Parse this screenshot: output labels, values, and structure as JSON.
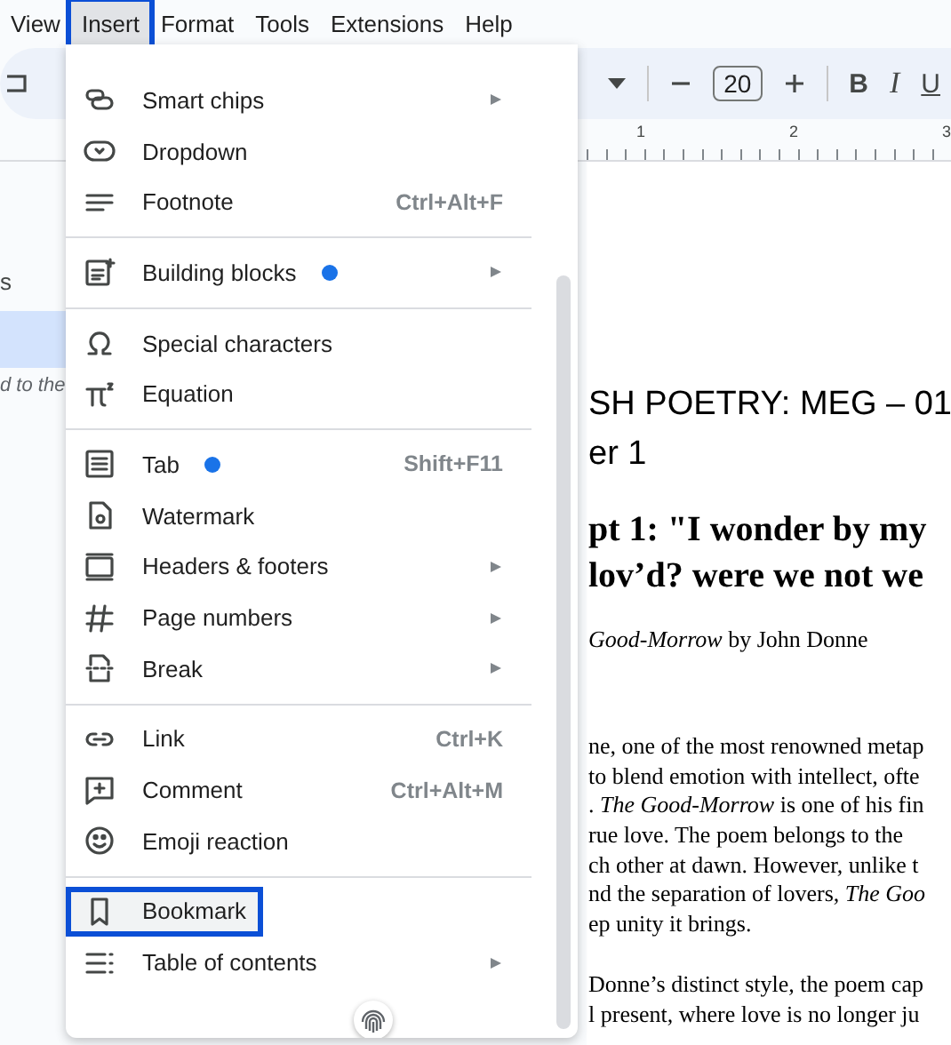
{
  "menu_bar": [
    {
      "label": "View",
      "selected": false,
      "annotated": false
    },
    {
      "label": "Insert",
      "selected": true,
      "annotated": true
    },
    {
      "label": "Format",
      "selected": false,
      "annotated": false
    },
    {
      "label": "Tools",
      "selected": false,
      "annotated": false
    },
    {
      "label": "Extensions",
      "selected": false,
      "annotated": false
    },
    {
      "label": "Help",
      "selected": false,
      "annotated": false
    }
  ],
  "toolbar": {
    "font_size": "20",
    "bold": "B",
    "italic": "I",
    "underline": "U"
  },
  "ruler": [
    "1",
    "2",
    "3"
  ],
  "sidebar": {
    "items": [
      {
        "label": "s",
        "selected": false
      },
      {
        "selected": true
      }
    ],
    "note": "d to the"
  },
  "insert_menu": {
    "sections": [
      [
        {
          "label": "Smart chips",
          "submenu": true,
          "new_dot": false,
          "highlighted": false,
          "annotated": false
        },
        {
          "label": "Dropdown",
          "submenu": false,
          "new_dot": false,
          "highlighted": false,
          "annotated": false
        },
        {
          "label": "Footnote",
          "shortcut": "Ctrl+Alt+F",
          "submenu": false,
          "new_dot": false,
          "highlighted": false,
          "annotated": false
        }
      ],
      [
        {
          "label": "Building blocks",
          "submenu": true,
          "new_dot": true,
          "highlighted": false,
          "annotated": false
        }
      ],
      [
        {
          "label": "Special characters",
          "submenu": false,
          "new_dot": false,
          "highlighted": false,
          "annotated": false
        },
        {
          "label": "Equation",
          "submenu": false,
          "new_dot": false,
          "highlighted": false,
          "annotated": false
        }
      ],
      [
        {
          "label": "Tab",
          "shortcut": "Shift+F11",
          "submenu": false,
          "new_dot": true,
          "highlighted": false,
          "annotated": false
        },
        {
          "label": "Watermark",
          "submenu": false,
          "new_dot": false,
          "highlighted": false,
          "annotated": false
        },
        {
          "label": "Headers & footers",
          "submenu": true,
          "new_dot": false,
          "highlighted": false,
          "annotated": false
        },
        {
          "label": "Page numbers",
          "submenu": true,
          "new_dot": false,
          "highlighted": false,
          "annotated": false
        },
        {
          "label": "Break",
          "submenu": true,
          "new_dot": false,
          "highlighted": false,
          "annotated": false
        }
      ],
      [
        {
          "label": "Link",
          "shortcut": "Ctrl+K",
          "submenu": false,
          "new_dot": false,
          "highlighted": false,
          "annotated": false
        },
        {
          "label": "Comment",
          "shortcut": "Ctrl+Alt+M",
          "submenu": false,
          "new_dot": false,
          "highlighted": false,
          "annotated": false
        },
        {
          "label": "Emoji reaction",
          "submenu": false,
          "new_dot": false,
          "highlighted": false,
          "annotated": false
        }
      ],
      [
        {
          "label": "Bookmark",
          "submenu": false,
          "new_dot": false,
          "highlighted": true,
          "annotated": true
        },
        {
          "label": "Table of contents",
          "submenu": true,
          "new_dot": false,
          "highlighted": false,
          "annotated": false
        }
      ]
    ]
  },
  "document": [
    {
      "kind": "title",
      "text": "SH POETRY: MEG – 01"
    },
    {
      "kind": "subtitle",
      "text": "er 1"
    },
    {
      "kind": "heading",
      "text": "pt 1: \"I wonder by my"
    },
    {
      "kind": "heading",
      "text": "lov’d? were we not we"
    },
    {
      "kind": "byline",
      "text": "*Good-Morrow* by John Donne"
    },
    {
      "kind": "gap"
    },
    {
      "kind": "body",
      "text": "ne, one of the most renowned metap"
    },
    {
      "kind": "body",
      "text": "to blend emotion with intellect, ofte"
    },
    {
      "kind": "body",
      "text": ". *The Good-Morrow* is one of his fin"
    },
    {
      "kind": "body",
      "text": "rue love. The poem belongs to the"
    },
    {
      "kind": "body",
      "text": "ch other at dawn. However, unlike t"
    },
    {
      "kind": "body",
      "text": "nd the separation of lovers, *The Goo*"
    },
    {
      "kind": "body",
      "text": "ep unity it brings."
    },
    {
      "kind": "space"
    },
    {
      "kind": "body",
      "text": "Donne’s distinct style, the poem cap"
    },
    {
      "kind": "body",
      "text": "l present, where love is no longer ju"
    }
  ]
}
